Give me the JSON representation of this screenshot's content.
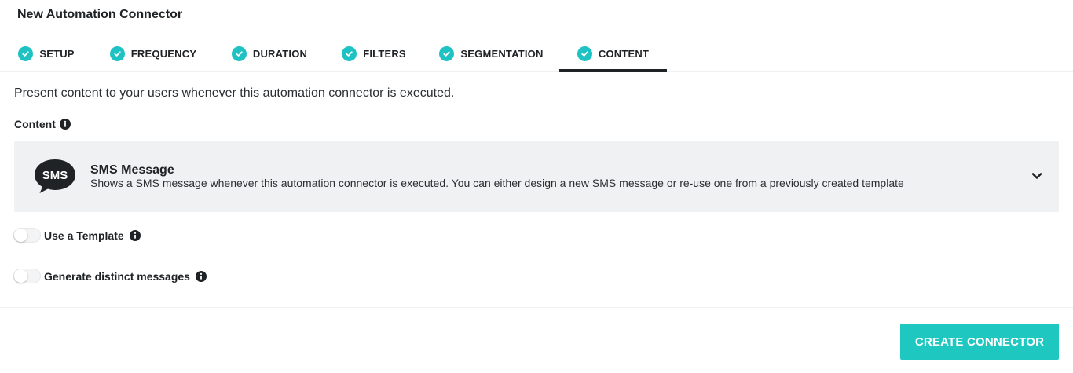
{
  "header": {
    "title": "New Automation Connector"
  },
  "tabs": [
    {
      "label": "SETUP",
      "icon": "check-circle-icon"
    },
    {
      "label": "FREQUENCY",
      "icon": "check-circle-icon"
    },
    {
      "label": "DURATION",
      "icon": "check-circle-icon"
    },
    {
      "label": "FILTERS",
      "icon": "check-circle-icon"
    },
    {
      "label": "SEGMENTATION",
      "icon": "check-circle-icon"
    },
    {
      "label": "CONTENT",
      "icon": "check-circle-icon"
    }
  ],
  "active_tab": "CONTENT",
  "intro_text": "Present content to your users whenever this automation connector is executed.",
  "content_section": {
    "label": "Content",
    "icon": "info-icon"
  },
  "sms_card": {
    "icon": "sms-bubble-icon",
    "icon_text": "SMS",
    "title": "SMS Message",
    "description": "Shows a SMS message whenever this automation connector is executed. You can either design a new SMS message or re-use one from a previously created template",
    "expand_icon": "chevron-down-icon"
  },
  "toggles": [
    {
      "label": "Use a Template",
      "enabled": false,
      "icon": "info-icon"
    },
    {
      "label": "Generate distinct messages",
      "enabled": false,
      "icon": "info-icon"
    }
  ],
  "footer": {
    "create_button": "CREATE CONNECTOR"
  },
  "colors": {
    "accent": "#1ec2c2",
    "button": "#1ec7bf",
    "text": "#1f2326",
    "card_bg": "#f0f1f2"
  }
}
